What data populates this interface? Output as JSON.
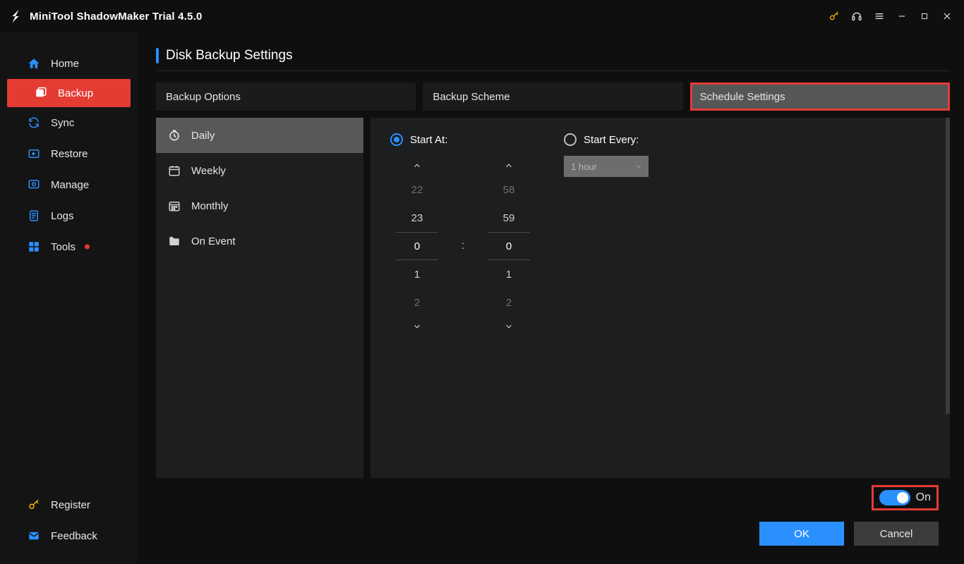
{
  "titlebar": {
    "title": "MiniTool ShadowMaker Trial 4.5.0"
  },
  "sidebar": {
    "items": [
      {
        "label": "Home"
      },
      {
        "label": "Backup"
      },
      {
        "label": "Sync"
      },
      {
        "label": "Restore"
      },
      {
        "label": "Manage"
      },
      {
        "label": "Logs"
      },
      {
        "label": "Tools"
      }
    ],
    "bottom": [
      {
        "label": "Register"
      },
      {
        "label": "Feedback"
      }
    ]
  },
  "page": {
    "title": "Disk Backup Settings"
  },
  "tabs": [
    {
      "label": "Backup Options"
    },
    {
      "label": "Backup Scheme"
    },
    {
      "label": "Schedule Settings"
    }
  ],
  "freq": [
    {
      "label": "Daily"
    },
    {
      "label": "Weekly"
    },
    {
      "label": "Monthly"
    },
    {
      "label": "On Event"
    }
  ],
  "schedule": {
    "start_at_label": "Start At:",
    "start_every_label": "Start Every:",
    "interval_value": "1 hour",
    "hours": {
      "m2": "22",
      "m1": "23",
      "sel": "0",
      "p1": "1",
      "p2": "2"
    },
    "mins": {
      "m2": "58",
      "m1": "59",
      "sel": "0",
      "p1": "1",
      "p2": "2"
    },
    "colon": ":"
  },
  "footer": {
    "toggle_label": "On",
    "ok": "OK",
    "cancel": "Cancel"
  }
}
